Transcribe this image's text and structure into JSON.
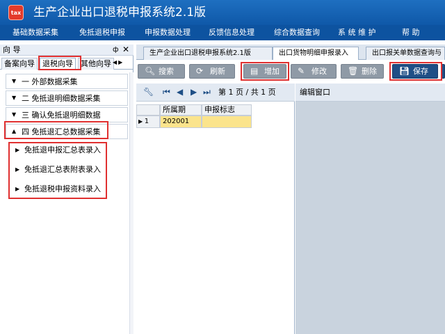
{
  "app": {
    "logo_text": "tax",
    "title": "生产企业出口退税申报系统2.1版"
  },
  "menu": [
    "基础数据采集",
    "免抵退税申报",
    "申报数据处理",
    "反馈信息处理",
    "综合数据查询",
    "系 统 维 护",
    "帮  助"
  ],
  "left_panel": {
    "title": "向 导",
    "pin_glyph": "ф",
    "close_glyph": "✕",
    "tabs": [
      "备案向导",
      "退税向导",
      "其他向导"
    ],
    "active_tab": "退税向导",
    "groups": [
      {
        "label": "一  外部数据采集",
        "expanded": false
      },
      {
        "label": "二  免抵退明细数据采集",
        "expanded": false
      },
      {
        "label": "三  确认免抵退明细数据",
        "expanded": false
      },
      {
        "label": "四  免抵退汇总数据采集",
        "expanded": true
      }
    ],
    "sub_items": [
      "免抵退申报汇总表录入",
      "免抵退汇总表附表录入",
      "免抵退税申报资料录入"
    ]
  },
  "doc_tabs": [
    "生产企业出口退税申报系统2.1版",
    "出口货物明细申报录入",
    "出口报关单数据查询与"
  ],
  "active_doc_tab": "出口货物明细申报录入",
  "toolbar": {
    "search": "搜索",
    "refresh": "刷新",
    "add": "增加",
    "edit": "修改",
    "delete": "删除",
    "save": "保存"
  },
  "pager": {
    "text": "第 1 页 / 共 1 页"
  },
  "grid": {
    "columns": [
      "所属期",
      "申报标志"
    ],
    "rows": [
      {
        "index": "1",
        "period": "202001",
        "flag": ""
      }
    ]
  },
  "edit_panel": {
    "title": "编辑窗口"
  }
}
